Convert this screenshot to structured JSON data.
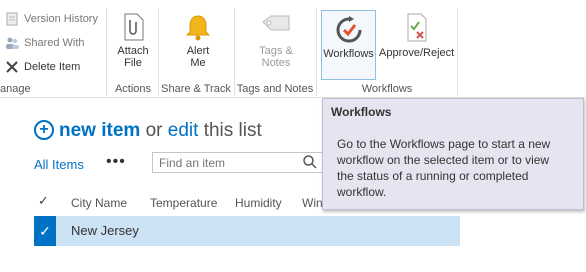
{
  "ribbon": {
    "manage": {
      "version_history": "Version History",
      "shared_with": "Shared With",
      "delete_item": "Delete Item",
      "label": "anage"
    },
    "actions": {
      "attach_file": "Attach File",
      "label": "Actions"
    },
    "share_track": {
      "alert_me": "Alert Me",
      "label": "Share & Track"
    },
    "tags_notes": {
      "tags_notes": "Tags & Notes",
      "label": "Tags and Notes"
    },
    "workflows_group": {
      "workflows": "Workflows",
      "approve_reject": "Approve/Reject",
      "label": "Workflows"
    }
  },
  "tooltip": {
    "title": "Workflows",
    "body": "Go to the Workflows page to start a new workflow on the selected item or to view the status of a running or completed workflow."
  },
  "list_title": {
    "new_item": "new item",
    "or": "or",
    "edit": "edit",
    "rest": "this list"
  },
  "view": {
    "all_items": "All Items",
    "more": "•••"
  },
  "search": {
    "placeholder": "Find an item"
  },
  "columns": [
    "City Name",
    "Temperature",
    "Humidity",
    "Win"
  ],
  "rows": [
    {
      "city": "New Jersey",
      "selected": true
    }
  ],
  "colors": {
    "accent": "#0072c6",
    "selected_row": "#cce2f5",
    "tooltip_bg": "#e5e5f1"
  }
}
